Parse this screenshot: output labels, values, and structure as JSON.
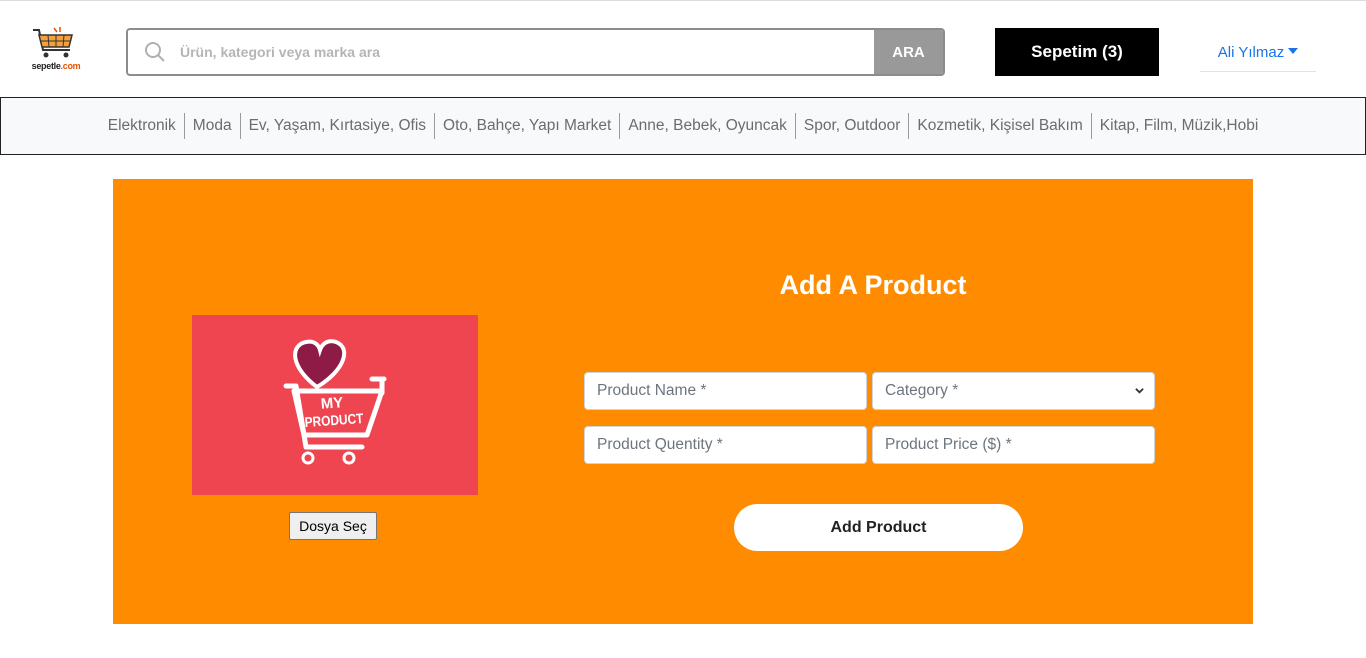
{
  "header": {
    "logo_text_brand": "sepetle",
    "logo_text_tld": ".com",
    "search": {
      "placeholder": "Ürün, kategori veya marka ara",
      "button_label": "ARA"
    },
    "cart_label": "Sepetim (3)",
    "user_name": "Ali Yılmaz"
  },
  "categories": [
    "Elektronik",
    "Moda",
    "Ev, Yaşam, Kırtasiye, Ofis",
    "Oto, Bahçe, Yapı Market",
    "Anne, Bebek, Oyuncak",
    "Spor, Outdoor",
    "Kozmetik, Kişisel Bakım",
    "Kitap, Film, Müzik,Hobi"
  ],
  "image_panel": {
    "logo_line1": "MY",
    "logo_line2": "PRODUCT",
    "file_button_label": "Dosya Seç"
  },
  "form": {
    "title": "Add A Product",
    "name_placeholder": "Product Name *",
    "category_selected": "Category *",
    "quantity_placeholder": "Product Quentity *",
    "price_placeholder": "Product Price ($) *",
    "submit_label": "Add Product"
  },
  "colors": {
    "panel_bg": "#ff8c00",
    "image_bg": "#ef4550",
    "link_blue": "#1a73e8",
    "cart_bg": "#000000"
  }
}
